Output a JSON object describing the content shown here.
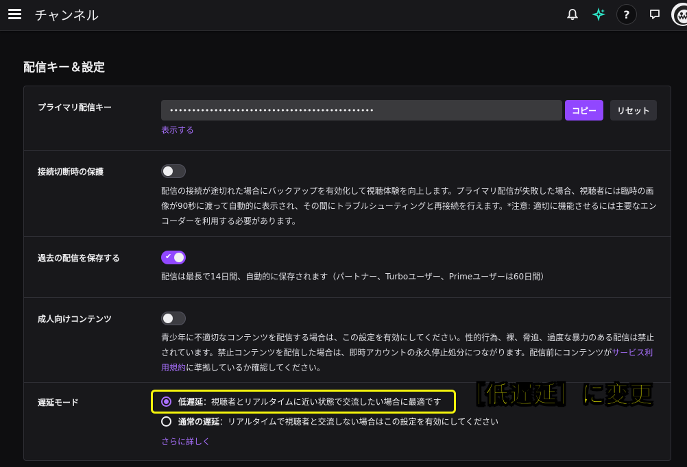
{
  "header": {
    "title": "チャンネル",
    "help_label": "?",
    "icons": [
      "menu-icon",
      "bell-icon",
      "sparkle-icon",
      "help-icon",
      "chat-icon",
      "avatar"
    ],
    "accent_color": "#2ee6c8"
  },
  "section_title": "配信キー＆設定",
  "stream_key": {
    "label": "プライマリ配信キー",
    "value": "••••••••••••••••••••••••••••••••••••••••••••••",
    "copy_label": "コピー",
    "reset_label": "リセット",
    "show_label": "表示する"
  },
  "disconnect_protection": {
    "label": "接続切断時の保護",
    "enabled": false,
    "description": "配信の接続が途切れた場合にバックアップを有効化して視聴体験を向上します。プライマリ配信が失敗した場合、視聴者には臨時の画像が90秒に渡って自動的に表示され、その間にトラブルシューティングと再接続を行えます。*注意: 適切に機能させるには主要なエンコーダーを利用する必要があります。"
  },
  "save_past": {
    "label": "過去の配信を保存する",
    "enabled": true,
    "description": "配信は最長で14日間、自動的に保存されます（パートナー、Turboユーザー、Primeユーザーは60日間）"
  },
  "mature": {
    "label": "成人向けコンテンツ",
    "enabled": false,
    "description": "青少年に不適切なコンテンツを配信する場合は、この設定を有効にしてください。性的行為、裸、脅迫、過度な暴力のある配信は禁止されています。禁止コンテンツを配信した場合は、即時アカウントの永久停止処分につながります。配信前にコンテンツが",
    "tos_link": "サービス利用規約",
    "description_end": "に準拠しているか確認してください。"
  },
  "latency": {
    "label": "遅延モード",
    "low_title": "低遅延",
    "low_desc": "：視聴者とリアルタイムに近い状態で交流したい場合に最適です",
    "normal_title": "通常の遅延",
    "normal_desc": "：リアルタイムで視聴者と交流しない場合はこの設定を有効にしてください",
    "selected": "low",
    "more_label": "さらに詳しく"
  },
  "annotation": {
    "text": "［低遅延］に変更",
    "color": "#fdff00"
  },
  "colors": {
    "accent": "#9147ff",
    "link": "#a970ff",
    "background": "#0e0e10",
    "panel": "#18181b"
  }
}
